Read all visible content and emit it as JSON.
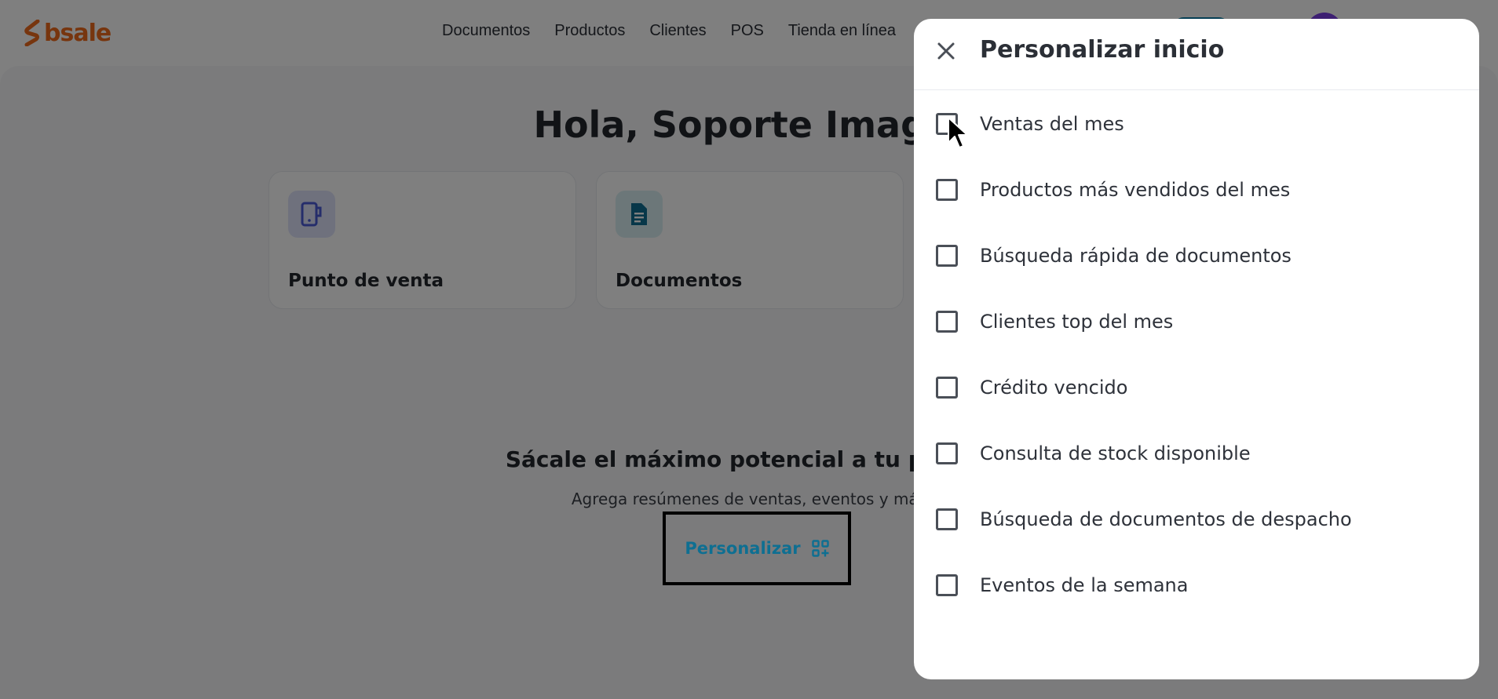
{
  "header": {
    "logo_text": "bsale",
    "nav": [
      "Documentos",
      "Productos",
      "Clientes",
      "POS",
      "Tienda en línea"
    ]
  },
  "main": {
    "greeting": "Hola, Soporte Imagin",
    "cards": [
      {
        "label": "Punto de venta",
        "icon": "pos-device-icon"
      },
      {
        "label": "Documentos",
        "icon": "document-icon"
      }
    ],
    "promo_title": "Sácale el máximo potencial a tu página",
    "promo_subtitle": "Agrega resúmenes de ventas, eventos y más",
    "personalize_label": "Personalizar"
  },
  "drawer": {
    "title": "Personalizar inicio",
    "options": [
      "Ventas del mes",
      "Productos más vendidos del mes",
      "Búsqueda rápida de documentos",
      "Clientes top del mes",
      "Crédito vencido",
      "Consulta de stock disponible",
      "Búsqueda de documentos de despacho",
      "Eventos de la semana"
    ]
  },
  "colors": {
    "brand": "#ee6b1d",
    "accent": "#0e6f92",
    "overlay": "rgba(0,0,0,0.5)"
  }
}
